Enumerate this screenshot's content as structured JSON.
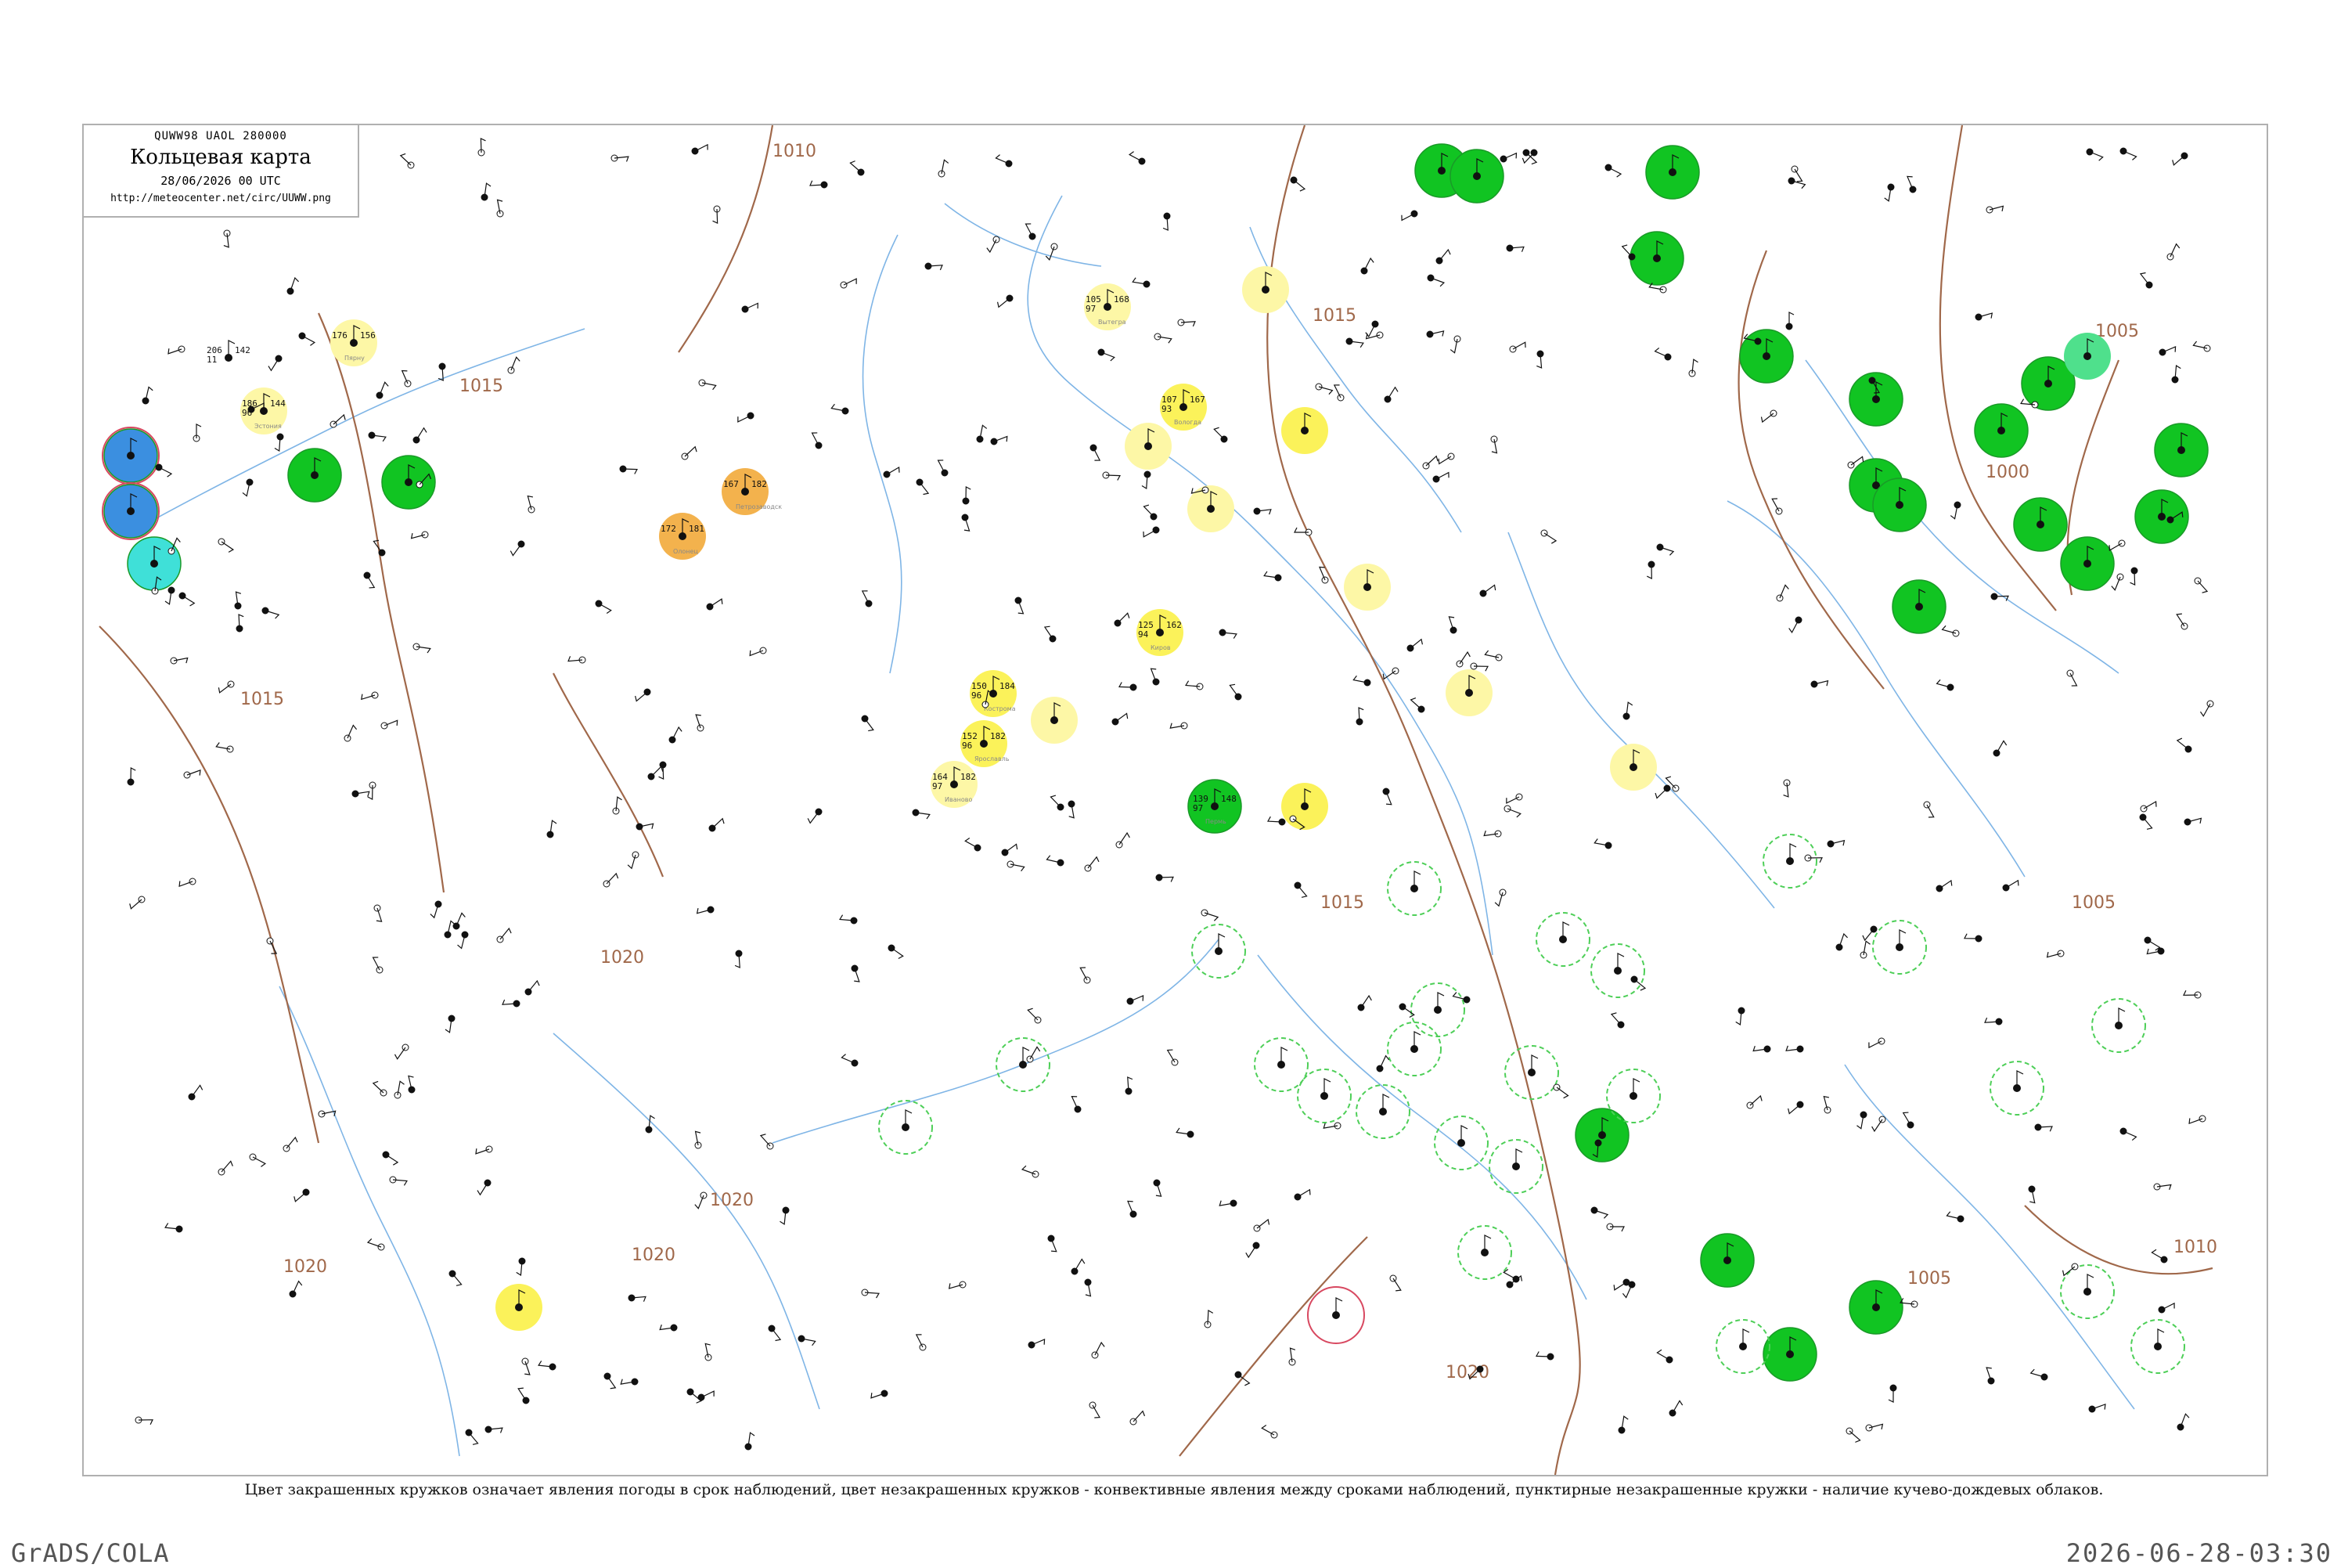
{
  "header": {
    "codes": "QUWW98  UAOL  280000",
    "title": "Кольцевая карта",
    "date": "28/06/2026 00 UTC",
    "url": "http://meteocenter.net/circ/UUWW.png"
  },
  "legend": "Цвет закрашенных кружков означает явления погоды в срок наблюдений, цвет незакрашенных кружков - конвективные явления между сроками наблюдений, пунктирные незакрашенные кружки - наличие кучево-дождевых облаков.",
  "footer": {
    "left": "GrADS/COLA",
    "right": "2026-06-28-03:30"
  },
  "colors": {
    "shower_green": "#11c422",
    "fog_yellow": "#fbf25a",
    "haze_yellow": "#fdf7a6",
    "dust_orange": "#f3b24d",
    "snow_blue": "#3b8fe0",
    "drizzle_cyan": "#3fe0d8",
    "cb_dashed": "#4ecf58",
    "isobar": "#a0684a",
    "river": "#7fb5e6"
  },
  "isobar_labels": [
    "1010",
    "1015",
    "1015",
    "1015",
    "1015",
    "1020",
    "1020",
    "1020",
    "1020",
    "1020",
    "1005",
    "1005",
    "1000",
    "1010",
    "1005"
  ],
  "stations": [
    {
      "t": "206",
      "p": "142",
      "td": "11",
      "w": "",
      "name": "",
      "fill": "none",
      "ring": "none"
    },
    {
      "t": "186",
      "p": "144",
      "td": "96",
      "w": "",
      "name": "Эстония",
      "fill": "haze_yellow",
      "ring": "none"
    },
    {
      "t": "176",
      "p": "156",
      "td": "",
      "w": "",
      "name": "Пярну",
      "fill": "haze_yellow",
      "ring": "none"
    },
    {
      "t": "",
      "p": "",
      "td": "",
      "w": "",
      "name": "",
      "fill": "shower_green",
      "ring": "none"
    },
    {
      "t": "",
      "p": "",
      "td": "",
      "w": "",
      "name": "",
      "fill": "shower_green",
      "ring": "none"
    },
    {
      "t": "",
      "p": "",
      "td": "",
      "w": "",
      "name": "",
      "fill": "snow_blue",
      "ring": "red"
    },
    {
      "t": "",
      "p": "",
      "td": "",
      "w": "",
      "name": "",
      "fill": "snow_blue",
      "ring": "red"
    },
    {
      "t": "",
      "p": "",
      "td": "",
      "w": "",
      "name": "",
      "fill": "drizzle_cyan",
      "ring": "none"
    },
    {
      "t": "172",
      "p": "181",
      "td": "",
      "w": "",
      "name": "Олонец",
      "fill": "dust_orange",
      "ring": "none"
    },
    {
      "t": "167",
      "p": "182",
      "td": "",
      "w": "",
      "name": "Петрозаводск",
      "fill": "dust_orange",
      "ring": "none"
    },
    {
      "t": "105",
      "p": "168",
      "td": "97",
      "w": "",
      "name": "Вытегра",
      "fill": "haze_yellow",
      "ring": "none"
    },
    {
      "t": "107",
      "p": "167",
      "td": "93",
      "w": "",
      "name": "Вологда",
      "fill": "fog_yellow",
      "ring": "none"
    },
    {
      "t": "150",
      "p": "184",
      "td": "96",
      "w": "",
      "name": "Кострома",
      "fill": "fog_yellow",
      "ring": "none"
    },
    {
      "t": "152",
      "p": "182",
      "td": "96",
      "w": "",
      "name": "Ярославль",
      "fill": "fog_yellow",
      "ring": "none"
    },
    {
      "t": "164",
      "p": "182",
      "td": "97",
      "w": "",
      "name": "Иваново",
      "fill": "haze_yellow",
      "ring": "none"
    },
    {
      "t": "125",
      "p": "162",
      "td": "94",
      "w": "",
      "name": "Киров",
      "fill": "fog_yellow",
      "ring": "none"
    },
    {
      "t": "139",
      "p": "148",
      "td": "97",
      "w": "",
      "name": "Пермь",
      "fill": "shower_green",
      "ring": "none"
    },
    {
      "t": "",
      "p": "",
      "td": "",
      "w": "",
      "name": "",
      "fill": "shower_green",
      "ring": "none"
    },
    {
      "t": "",
      "p": "",
      "td": "",
      "w": "",
      "name": "",
      "fill": "shower_green",
      "ring": "none"
    },
    {
      "t": "",
      "p": "",
      "td": "",
      "w": "",
      "name": "",
      "fill": "shower_green",
      "ring": "none"
    },
    {
      "t": "",
      "p": "",
      "td": "",
      "w": "",
      "name": "",
      "fill": "shower_green",
      "ring": "none"
    },
    {
      "t": "",
      "p": "",
      "td": "",
      "w": "",
      "name": "",
      "fill": "shower_green",
      "ring": "none"
    },
    {
      "t": "",
      "p": "",
      "td": "",
      "w": "",
      "name": "",
      "fill": "shower_green",
      "ring": "none"
    },
    {
      "t": "",
      "p": "",
      "td": "",
      "w": "",
      "name": "",
      "fill": "shower_green",
      "ring": "none"
    },
    {
      "t": "",
      "p": "",
      "td": "",
      "w": "",
      "name": "",
      "fill": "shower_green",
      "ring": "none"
    },
    {
      "t": "",
      "p": "",
      "td": "",
      "w": "",
      "name": "",
      "fill": "shower_green",
      "ring": "none"
    },
    {
      "t": "",
      "p": "",
      "td": "",
      "w": "",
      "name": "",
      "fill": "shower_green",
      "ring": "none"
    },
    {
      "t": "",
      "p": "",
      "td": "",
      "w": "",
      "name": "",
      "fill": "shower_green",
      "ring": "none"
    },
    {
      "t": "",
      "p": "",
      "td": "",
      "w": "",
      "name": "",
      "fill": "shower_green",
      "ring": "none"
    },
    {
      "t": "",
      "p": "",
      "td": "",
      "w": "",
      "name": "",
      "fill": "shower_green",
      "ring": "none"
    },
    {
      "t": "",
      "p": "",
      "td": "",
      "w": "",
      "name": "",
      "fill": "shower_green",
      "ring": "none"
    },
    {
      "t": "",
      "p": "",
      "td": "",
      "w": "",
      "name": "",
      "fill": "shower_green",
      "ring": "none"
    },
    {
      "t": "",
      "p": "",
      "td": "",
      "w": "",
      "name": "",
      "fill": "shower_green",
      "ring": "none"
    },
    {
      "t": "",
      "p": "",
      "td": "",
      "w": "",
      "name": "",
      "fill": "shower_green",
      "ring": "none"
    },
    {
      "t": "",
      "p": "",
      "td": "",
      "w": "",
      "name": "",
      "fill": "shower_green",
      "ring": "none"
    },
    {
      "t": "",
      "p": "",
      "td": "",
      "w": "",
      "name": "",
      "fill": "shower_green",
      "ring": "none"
    },
    {
      "t": "",
      "p": "",
      "td": "",
      "w": "",
      "name": "",
      "fill": "mint",
      "ring": "none"
    },
    {
      "t": "",
      "p": "",
      "td": "",
      "w": "",
      "name": "",
      "fill": "haze_yellow",
      "ring": "none"
    },
    {
      "t": "",
      "p": "",
      "td": "",
      "w": "",
      "name": "",
      "fill": "haze_yellow",
      "ring": "none"
    },
    {
      "t": "",
      "p": "",
      "td": "",
      "w": "",
      "name": "",
      "fill": "haze_yellow",
      "ring": "none"
    },
    {
      "t": "",
      "p": "",
      "td": "",
      "w": "",
      "name": "",
      "fill": "haze_yellow",
      "ring": "none"
    },
    {
      "t": "",
      "p": "",
      "td": "",
      "w": "",
      "name": "",
      "fill": "haze_yellow",
      "ring": "none"
    },
    {
      "t": "",
      "p": "",
      "td": "",
      "w": "",
      "name": "",
      "fill": "haze_yellow",
      "ring": "none"
    },
    {
      "t": "",
      "p": "",
      "td": "",
      "w": "",
      "name": "",
      "fill": "fog_yellow",
      "ring": "none"
    },
    {
      "t": "",
      "p": "",
      "td": "",
      "w": "",
      "name": "",
      "fill": "fog_yellow",
      "ring": "none"
    },
    {
      "t": "",
      "p": "",
      "td": "",
      "w": "",
      "name": "",
      "fill": "none",
      "ring": "cb_dashed"
    },
    {
      "t": "",
      "p": "",
      "td": "",
      "w": "",
      "name": "",
      "fill": "none",
      "ring": "cb_dashed"
    },
    {
      "t": "",
      "p": "",
      "td": "",
      "w": "",
      "name": "",
      "fill": "none",
      "ring": "cb_dashed"
    },
    {
      "t": "",
      "p": "",
      "td": "",
      "w": "",
      "name": "",
      "fill": "none",
      "ring": "cb_dashed"
    },
    {
      "t": "",
      "p": "",
      "td": "",
      "w": "",
      "name": "",
      "fill": "none",
      "ring": "cb_dashed"
    },
    {
      "t": "",
      "p": "",
      "td": "",
      "w": "",
      "name": "",
      "fill": "none",
      "ring": "cb_dashed"
    },
    {
      "t": "",
      "p": "",
      "td": "",
      "w": "",
      "name": "",
      "fill": "none",
      "ring": "cb_dashed"
    },
    {
      "t": "",
      "p": "",
      "td": "",
      "w": "",
      "name": "",
      "fill": "none",
      "ring": "cb_dashed"
    },
    {
      "t": "",
      "p": "",
      "td": "",
      "w": "",
      "name": "",
      "fill": "none",
      "ring": "cb_dashed"
    },
    {
      "t": "",
      "p": "",
      "td": "",
      "w": "",
      "name": "",
      "fill": "none",
      "ring": "cb_dashed"
    },
    {
      "t": "",
      "p": "",
      "td": "",
      "w": "",
      "name": "",
      "fill": "none",
      "ring": "cb_dashed"
    },
    {
      "t": "",
      "p": "",
      "td": "",
      "w": "",
      "name": "",
      "fill": "none",
      "ring": "cb_dashed"
    },
    {
      "t": "",
      "p": "",
      "td": "",
      "w": "",
      "name": "",
      "fill": "none",
      "ring": "cb_dashed"
    },
    {
      "t": "",
      "p": "",
      "td": "",
      "w": "",
      "name": "",
      "fill": "none",
      "ring": "cb_dashed"
    },
    {
      "t": "",
      "p": "",
      "td": "",
      "w": "",
      "name": "",
      "fill": "none",
      "ring": "cb_dashed"
    },
    {
      "t": "",
      "p": "",
      "td": "",
      "w": "",
      "name": "",
      "fill": "none",
      "ring": "cb_dashed"
    },
    {
      "t": "",
      "p": "",
      "td": "",
      "w": "",
      "name": "",
      "fill": "none",
      "ring": "cb_dashed"
    },
    {
      "t": "",
      "p": "",
      "td": "",
      "w": "",
      "name": "",
      "fill": "none",
      "ring": "cb_dashed"
    },
    {
      "t": "",
      "p": "",
      "td": "",
      "w": "",
      "name": "",
      "fill": "none",
      "ring": "cb_dashed"
    },
    {
      "t": "",
      "p": "",
      "td": "",
      "w": "",
      "name": "",
      "fill": "none",
      "ring": "cb_dashed"
    },
    {
      "t": "",
      "p": "",
      "td": "",
      "w": "",
      "name": "",
      "fill": "none",
      "ring": "cb_dashed"
    },
    {
      "t": "",
      "p": "",
      "td": "",
      "w": "",
      "name": "",
      "fill": "none",
      "ring": "cb_dashed"
    },
    {
      "t": "",
      "p": "",
      "td": "",
      "w": "",
      "name": "",
      "fill": "none",
      "ring": "cb_dashed"
    },
    {
      "t": "",
      "p": "",
      "td": "",
      "w": "",
      "name": "",
      "fill": "none",
      "ring": "red"
    },
    {
      "t": "",
      "p": "",
      "td": "",
      "w": "",
      "name": "",
      "fill": "fog_yellow",
      "ring": "none"
    },
    {
      "t": "",
      "p": "",
      "td": "",
      "w": "",
      "name": "",
      "fill": "haze_yellow",
      "ring": "none"
    }
  ]
}
